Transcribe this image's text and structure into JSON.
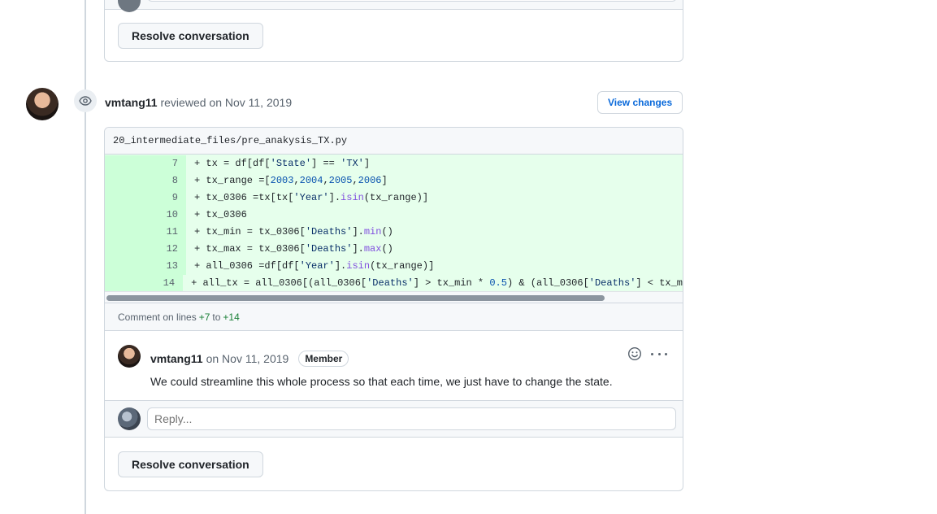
{
  "top_thread": {
    "resolve_label": "Resolve conversation"
  },
  "review": {
    "author": "vmtang11",
    "action": "reviewed on Nov 11, 2019",
    "view_changes_label": "View changes",
    "file_path": "20_intermediate_files/pre_anakysis_TX.py",
    "code_lines": [
      {
        "num": "7",
        "text": "+ tx = df[df['State'] == 'TX']"
      },
      {
        "num": "8",
        "text": "+ tx_range =[2003,2004,2005,2006]"
      },
      {
        "num": "9",
        "text": "+ tx_0306 =tx[tx['Year'].isin(tx_range)]"
      },
      {
        "num": "10",
        "text": "+ tx_0306"
      },
      {
        "num": "11",
        "text": "+ tx_min = tx_0306['Deaths'].min()"
      },
      {
        "num": "12",
        "text": "+ tx_max = tx_0306['Deaths'].max()"
      },
      {
        "num": "13",
        "text": "+ all_0306 =df[df['Year'].isin(tx_range)]"
      },
      {
        "num": "14",
        "text": "+ all_tx = all_0306[(all_0306['Deaths'] > tx_min * 0.5) & (all_0306['Deaths'] < tx_m"
      }
    ],
    "comment_on_prefix": "Comment on lines",
    "comment_on_from": "+7",
    "comment_on_to_word": "to",
    "comment_on_to": "+14"
  },
  "comment": {
    "author": "vmtang11",
    "date": "on Nov 11, 2019",
    "badge": "Member",
    "body": "We could streamline this whole process so that each time, we just have to change the state."
  },
  "reply": {
    "placeholder": "Reply..."
  },
  "main_thread": {
    "resolve_label": "Resolve conversation"
  },
  "icons": [
    "eye-icon",
    "smiley-icon",
    "kebab-horizontal-icon"
  ],
  "colors": {
    "addition_bg": "#e6ffec",
    "addition_num_bg": "#ccffd8",
    "link": "#0969da",
    "border": "#d0d7de"
  }
}
